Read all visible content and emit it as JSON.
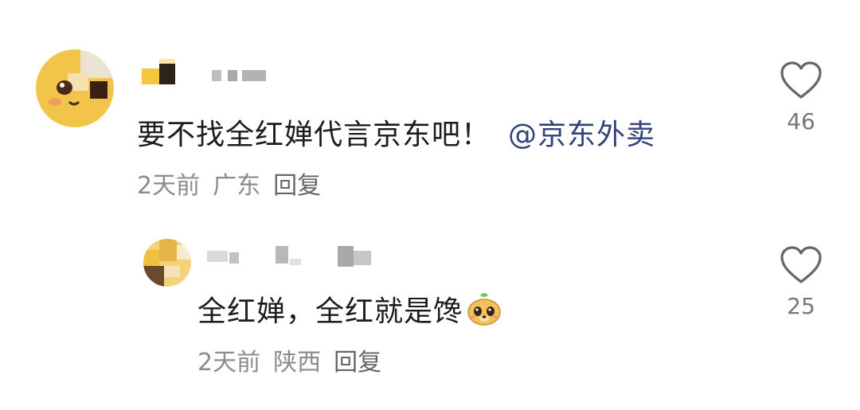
{
  "comments": [
    {
      "text": "要不找全红婵代言京东吧！",
      "mention": "@京东外卖",
      "time": "2天前",
      "location": "广东",
      "reply_label": "回复",
      "likes": "46"
    },
    {
      "text": "全红婵，全红就是馋",
      "emoji_name": "puppy-emoji",
      "time": "2天前",
      "location": "陕西",
      "reply_label": "回复",
      "likes": "25"
    }
  ],
  "colors": {
    "text": "#1c1c1c",
    "mention": "#33427a",
    "meta": "#8c8c8c",
    "icon": "#666666"
  },
  "icons": [
    "heart-icon",
    "puppy-emoji"
  ]
}
